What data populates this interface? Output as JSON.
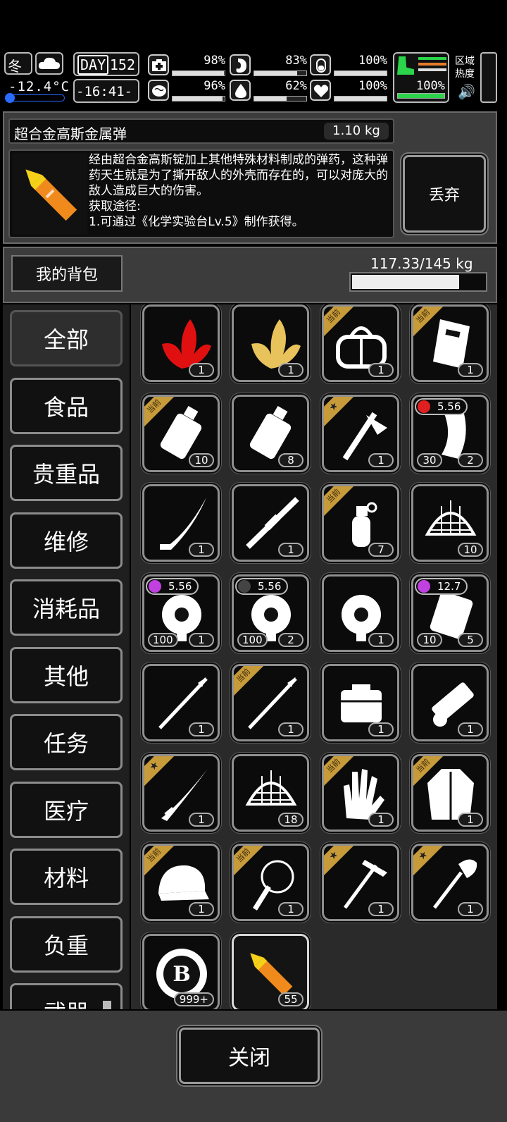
{
  "hud": {
    "season": "冬",
    "temperature": "-12.4°C",
    "day_label": "DAY",
    "day_number": "152",
    "clock": "-16:41-",
    "stats": [
      {
        "icon": "medkit-icon",
        "value": "98%",
        "fill": 0.98
      },
      {
        "icon": "stomach-icon",
        "value": "83%",
        "fill": 0.83
      },
      {
        "icon": "bladder-icon",
        "value": "100%",
        "fill": 1.0
      },
      {
        "icon": "brain-icon",
        "value": "96%",
        "fill": 0.96
      },
      {
        "icon": "water-drop-icon",
        "value": "62%",
        "fill": 0.62
      },
      {
        "icon": "heart-icon",
        "value": "100%",
        "fill": 1.0
      }
    ],
    "stamina": "100%",
    "zone_heat_label": "区域热度"
  },
  "item_detail": {
    "name": "超合金高斯金属弹",
    "weight": "1.10 kg",
    "description": "经由超合金高斯锭加上其他特殊材料制成的弹药，这种弹药天生就是为了撕开敌人的外壳而存在的，可以对庞大的敌人造成巨大的伤害。",
    "source_title": "获取途径:",
    "source_line": "1.可通过《化学实验台Lv.5》制作获得。",
    "discard_label": "丢弃"
  },
  "backpack": {
    "title": "我的背包",
    "capacity": "117.33/145 kg",
    "fill": 0.809
  },
  "categories": [
    "全部",
    "食品",
    "贵重品",
    "维修",
    "消耗品",
    "其他",
    "任务",
    "医疗",
    "材料",
    "负重",
    "武器"
  ],
  "ribbon_text": "当前",
  "items": [
    {
      "icon": "red-leaves-icon",
      "qty": "1",
      "ribbon": ""
    },
    {
      "icon": "yellow-leaves-icon",
      "qty": "1",
      "ribbon": ""
    },
    {
      "icon": "duffel-bag-icon",
      "qty": "1",
      "ribbon": "current"
    },
    {
      "icon": "riot-shield-icon",
      "qty": "1",
      "ribbon": "current"
    },
    {
      "icon": "canister-icon",
      "qty": "10",
      "ribbon": "current"
    },
    {
      "icon": "canister-icon",
      "qty": "8",
      "ribbon": ""
    },
    {
      "icon": "hatchet-icon",
      "qty": "1",
      "ribbon": "star"
    },
    {
      "icon": "rifle-magazine-icon",
      "qty": "2",
      "qty2": "30",
      "caliber": "5.56",
      "caliber_color": "#e02020",
      "ribbon": ""
    },
    {
      "icon": "curved-blade-icon",
      "qty": "1",
      "ribbon": ""
    },
    {
      "icon": "sniper-rifle-icon",
      "qty": "1",
      "ribbon": ""
    },
    {
      "icon": "grenade-icon",
      "qty": "7",
      "ribbon": "current"
    },
    {
      "icon": "net-trap-icon",
      "qty": "10",
      "ribbon": ""
    },
    {
      "icon": "drum-magazine-icon",
      "qty": "1",
      "qty2": "100",
      "caliber": "5.56",
      "caliber_color": "#c040e0",
      "ribbon": ""
    },
    {
      "icon": "drum-magazine-icon",
      "qty": "2",
      "qty2": "100",
      "caliber": "5.56",
      "caliber_color": "#444444",
      "ribbon": ""
    },
    {
      "icon": "drum-magazine-icon",
      "qty": "1",
      "ribbon": ""
    },
    {
      "icon": "box-magazine-icon",
      "qty": "5",
      "qty2": "10",
      "caliber": "12.7",
      "caliber_color": "#c040e0",
      "ribbon": ""
    },
    {
      "icon": "spear-icon",
      "qty": "1",
      "ribbon": ""
    },
    {
      "icon": "spear-icon",
      "qty": "1",
      "ribbon": "current"
    },
    {
      "icon": "ammo-box-icon",
      "qty": "1",
      "ribbon": ""
    },
    {
      "icon": "heavy-gun-icon",
      "qty": "1",
      "ribbon": ""
    },
    {
      "icon": "katana-icon",
      "qty": "1",
      "ribbon": "star"
    },
    {
      "icon": "net-trap-icon",
      "qty": "18",
      "ribbon": ""
    },
    {
      "icon": "gloves-icon",
      "qty": "1",
      "ribbon": "current"
    },
    {
      "icon": "coat-icon",
      "qty": "1",
      "ribbon": "current"
    },
    {
      "icon": "cap-icon",
      "qty": "1",
      "ribbon": "current"
    },
    {
      "icon": "whip-icon",
      "qty": "1",
      "ribbon": "current"
    },
    {
      "icon": "pickaxe-icon",
      "qty": "1",
      "ribbon": "star"
    },
    {
      "icon": "shovel-icon",
      "qty": "1",
      "ribbon": "star"
    },
    {
      "icon": "coin-icon",
      "qty": "999+",
      "ribbon": ""
    },
    {
      "icon": "gauss-bullet-icon",
      "qty": "55",
      "ribbon": "",
      "selected": true
    }
  ],
  "close_label": "关闭"
}
